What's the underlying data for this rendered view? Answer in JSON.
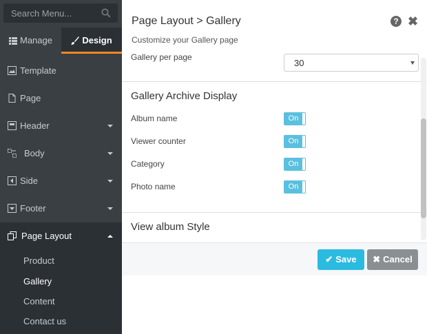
{
  "sidebar": {
    "search_placeholder": "Search Menu...",
    "tabs": {
      "manage": "Manage",
      "design": "Design"
    },
    "items": [
      {
        "label": "Template",
        "icon": "image-icon"
      },
      {
        "label": "Page",
        "icon": "file-icon"
      },
      {
        "label": "Header",
        "icon": "header-icon"
      },
      {
        "label": "Body",
        "icon": "body-icon"
      },
      {
        "label": "Side",
        "icon": "side-icon"
      },
      {
        "label": "Footer",
        "icon": "footer-icon"
      },
      {
        "label": "Page Layout",
        "icon": "copy-icon"
      }
    ],
    "subitems": [
      "Product",
      "Gallery",
      "Content",
      "Contact us"
    ]
  },
  "panel": {
    "title": "Page Layout > Gallery",
    "subtitle": "Customize your Gallery page",
    "gallery_per_page_label": "Gallery per page",
    "gallery_per_page_value": "30",
    "archive_section_title": "Gallery Archive Display",
    "rows": [
      {
        "label": "Album name",
        "toggle": "On"
      },
      {
        "label": "Viewer counter",
        "toggle": "On"
      },
      {
        "label": "Category",
        "toggle": "On"
      },
      {
        "label": "Photo name",
        "toggle": "On"
      }
    ],
    "album_style_title": "View album Style"
  },
  "footer": {
    "save_label": "Save",
    "cancel_label": "Cancel"
  },
  "colors": {
    "sidebar_bg": "#3a3f44",
    "accent": "#f08a24",
    "toggle": "#5bc0de",
    "save": "#2bbbe0",
    "cancel": "#8a8f94"
  }
}
